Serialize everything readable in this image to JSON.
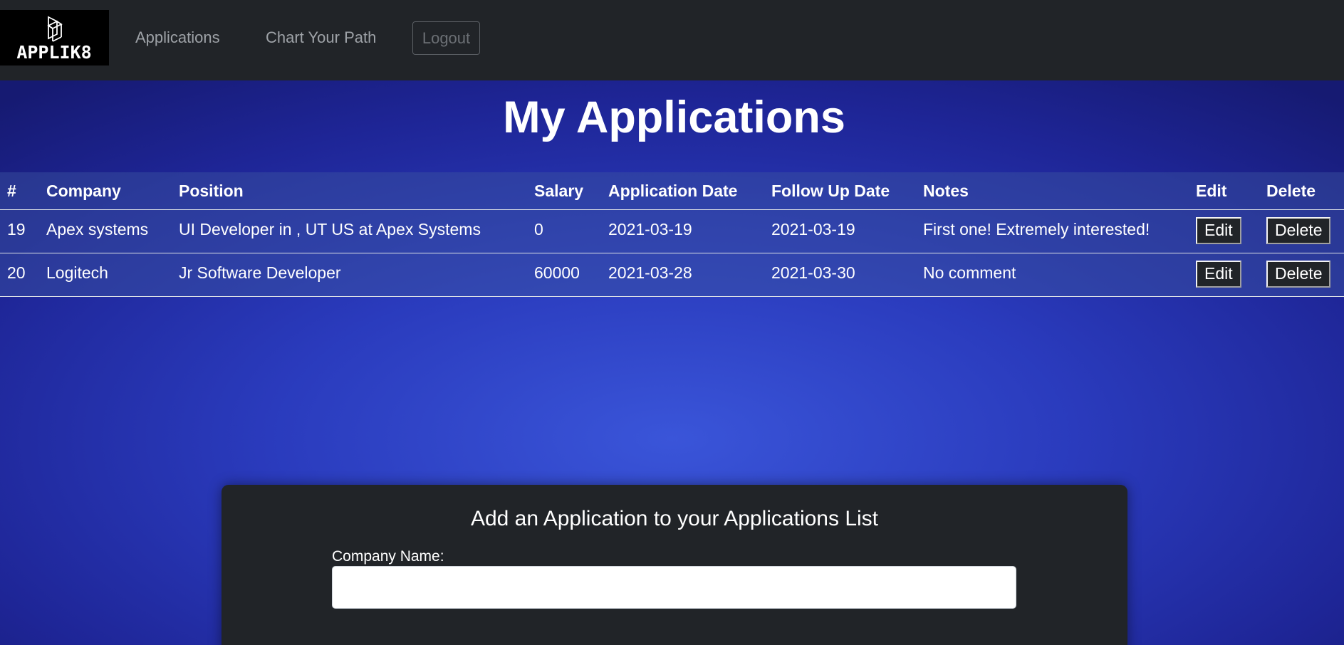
{
  "nav": {
    "logo_text": "APPLIK8",
    "links": [
      "Applications",
      "Chart Your Path"
    ],
    "logout_label": "Logout"
  },
  "page_title": "My Applications",
  "table": {
    "headers": [
      "#",
      "Company",
      "Position",
      "Salary",
      "Application Date",
      "Follow Up Date",
      "Notes",
      "Edit",
      "Delete"
    ],
    "rows": [
      {
        "id": "19",
        "company": "Apex systems",
        "position": "UI Developer in , UT US at Apex Systems",
        "salary": "0",
        "app_date": "2021-03-19",
        "follow_up": "2021-03-19",
        "notes": "First one! Extremely interested!",
        "edit": "Edit",
        "delete": "Delete"
      },
      {
        "id": "20",
        "company": "Logitech",
        "position": "Jr Software Developer",
        "salary": "60000",
        "app_date": "2021-03-28",
        "follow_up": "2021-03-30",
        "notes": "No comment",
        "edit": "Edit",
        "delete": "Delete"
      }
    ]
  },
  "form": {
    "title": "Add an Application to your Applications List",
    "company_label": "Company Name:",
    "company_value": "",
    "company_placeholder": ""
  },
  "colors": {
    "navbar": "#212428",
    "background_center": "#3a55d9",
    "background_edge": "#161a72"
  }
}
